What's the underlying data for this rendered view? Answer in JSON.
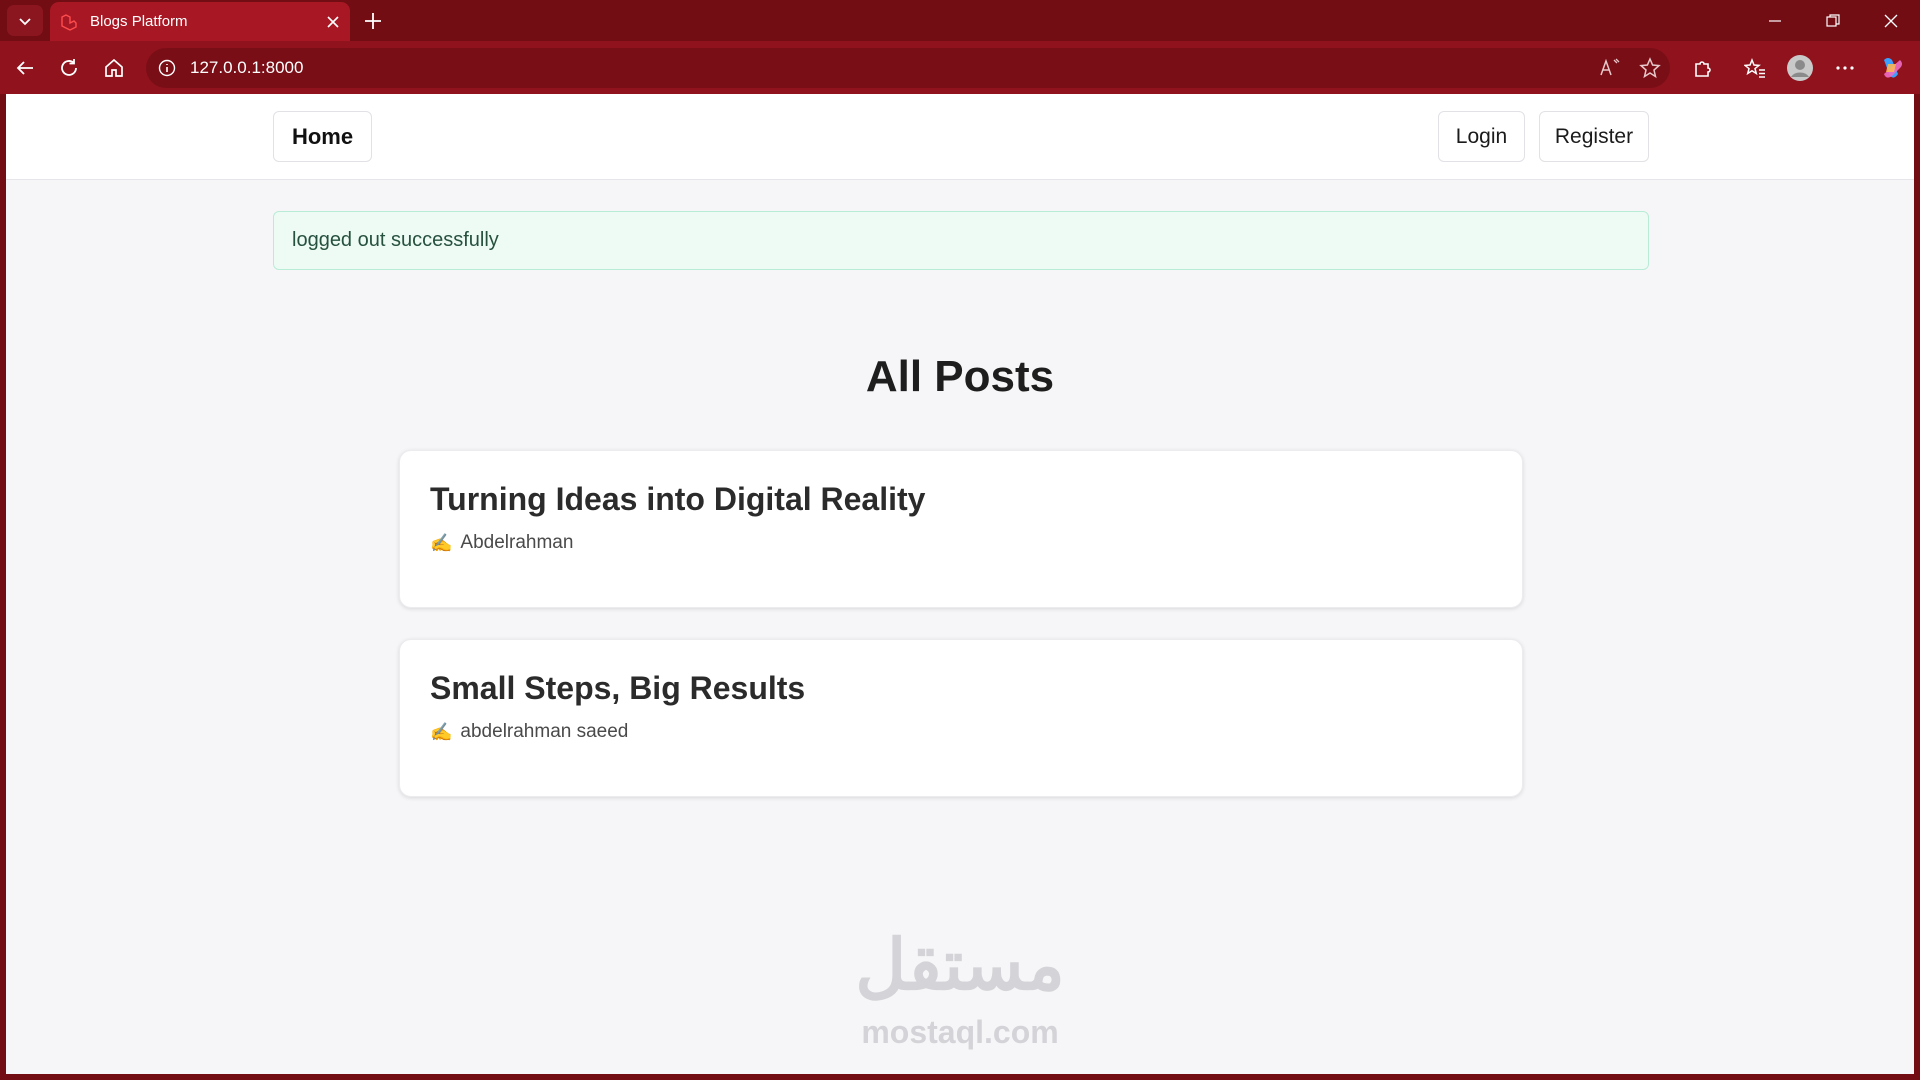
{
  "browser": {
    "tab_title": "Blogs Platform",
    "url": "127.0.0.1:8000"
  },
  "nav": {
    "home": "Home",
    "login": "Login",
    "register": "Register"
  },
  "flash_message": "logged out successfully",
  "page_title": "All Posts",
  "posts": [
    {
      "title": "Turning Ideas into Digital Reality",
      "author": "Abdelrahman",
      "author_icon": "✍️"
    },
    {
      "title": "Small Steps, Big Results",
      "author": "abdelrahman saeed",
      "author_icon": "✍️"
    }
  ],
  "watermark": {
    "arabic": "مستقل",
    "latin": "mostaql.com"
  },
  "colors": {
    "chrome": "#720d14",
    "chrome_address": "#8f121d",
    "page_bg": "#f6f6f8",
    "flash_bg": "#eefbf5"
  }
}
